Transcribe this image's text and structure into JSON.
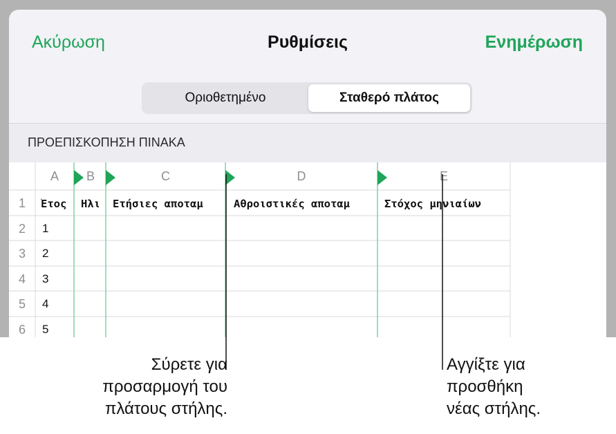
{
  "nav": {
    "cancel": "Ακύρωση",
    "title": "Ρυθμίσεις",
    "update": "Ενημέρωση"
  },
  "segments": [
    "Οριοθετημένο",
    "Σταθερό πλάτος"
  ],
  "selected_segment": 1,
  "section_header": "ΠΡΟΕΠΙΣΚΟΠΗΣΗ ΠΙΝΑΚΑ",
  "table": {
    "column_headers": [
      "A",
      "B",
      "C",
      "D",
      "E"
    ],
    "row_headers": [
      "1",
      "2",
      "3",
      "4",
      "5",
      "6"
    ],
    "header_cells": [
      "Έτος",
      "Ηλι",
      "Ετήσιες αποταμ",
      "Αθροιστικές αποταμ",
      "Στόχος μηνιαίων"
    ],
    "first_column_values": [
      "1",
      "2",
      "3",
      "4",
      "5"
    ]
  },
  "callouts": {
    "drag": [
      "Σύρετε για",
      "προσαρμογή του",
      "πλάτους στήλης."
    ],
    "tap": [
      "Αγγίξτε για",
      "προσθήκη",
      "νέας στήλης."
    ]
  },
  "colors": {
    "accent": "#1fa558",
    "marker": "#1fa558",
    "backdrop": "#b3b3b3"
  }
}
